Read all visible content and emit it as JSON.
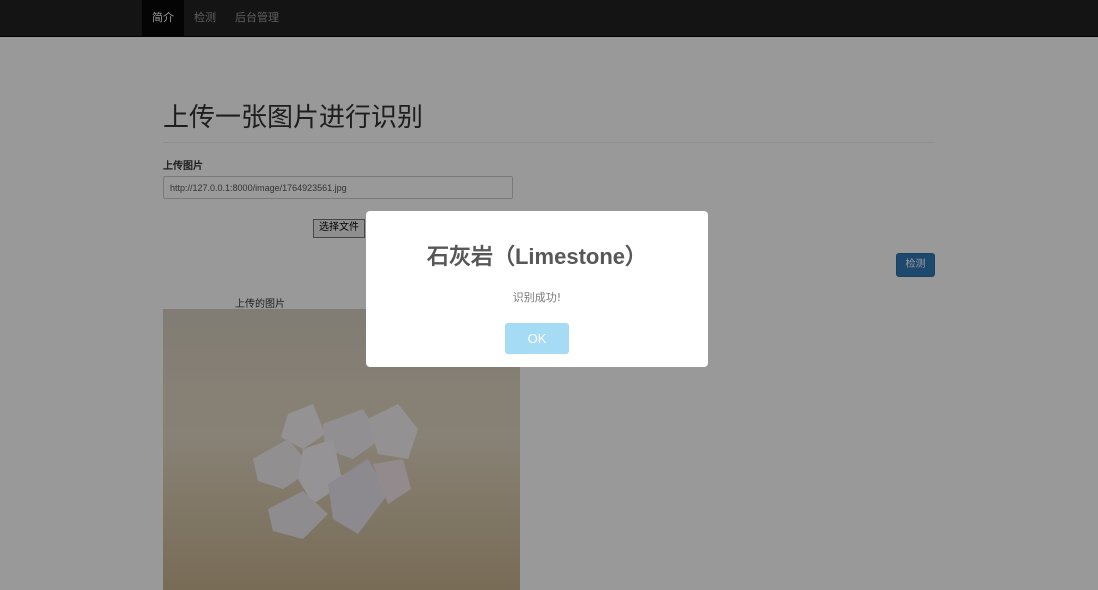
{
  "navbar": {
    "items": [
      {
        "label": "简介",
        "active": true
      },
      {
        "label": "检测",
        "active": false
      },
      {
        "label": "后台管理",
        "active": false
      }
    ]
  },
  "main": {
    "title": "上传一张图片进行识别",
    "upload_label": "上传图片",
    "image_url_value": "http://127.0.0.1:8000/image/1764923561.jpg",
    "choose_file_label": "选择文件",
    "detect_button_label": "检测",
    "uploaded_caption": "上传的图片"
  },
  "modal": {
    "title": "石灰岩（Limestone）",
    "message": "识别成功!",
    "ok_label": "OK"
  },
  "colors": {
    "navbar_bg": "#222222",
    "primary": "#337ab7",
    "ok_button": "#a5dbf5"
  }
}
